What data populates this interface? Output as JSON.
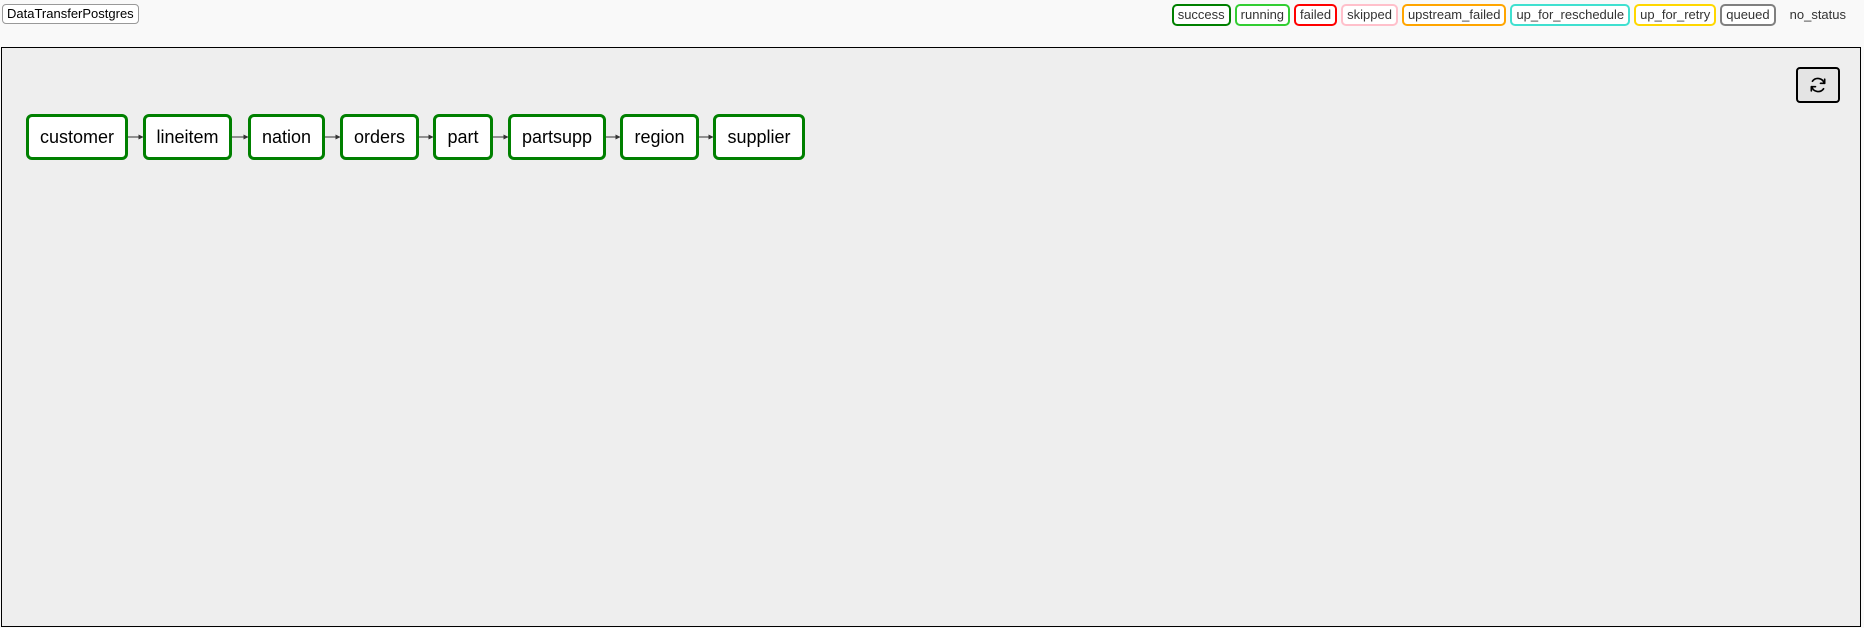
{
  "dag": {
    "title": "DataTransferPostgres"
  },
  "legend": [
    {
      "label": "success",
      "color": "#008000"
    },
    {
      "label": "running",
      "color": "#32cd32"
    },
    {
      "label": "failed",
      "color": "#ff0000"
    },
    {
      "label": "skipped",
      "color": "#ffc0cb"
    },
    {
      "label": "upstream_failed",
      "color": "#ffa500"
    },
    {
      "label": "up_for_reschedule",
      "color": "#40e0d0"
    },
    {
      "label": "up_for_retry",
      "color": "#ffd700"
    },
    {
      "label": "queued",
      "color": "#808080"
    },
    {
      "label": "no_status",
      "color": "none"
    }
  ],
  "toolbar": {
    "refresh_icon": "refresh-icon"
  },
  "graph": {
    "nodes": [
      {
        "label": "customer",
        "state": "success"
      },
      {
        "label": "lineitem",
        "state": "success"
      },
      {
        "label": "nation",
        "state": "success"
      },
      {
        "label": "orders",
        "state": "success"
      },
      {
        "label": "part",
        "state": "success"
      },
      {
        "label": "partsupp",
        "state": "success"
      },
      {
        "label": "region",
        "state": "success"
      },
      {
        "label": "supplier",
        "state": "success"
      }
    ]
  }
}
